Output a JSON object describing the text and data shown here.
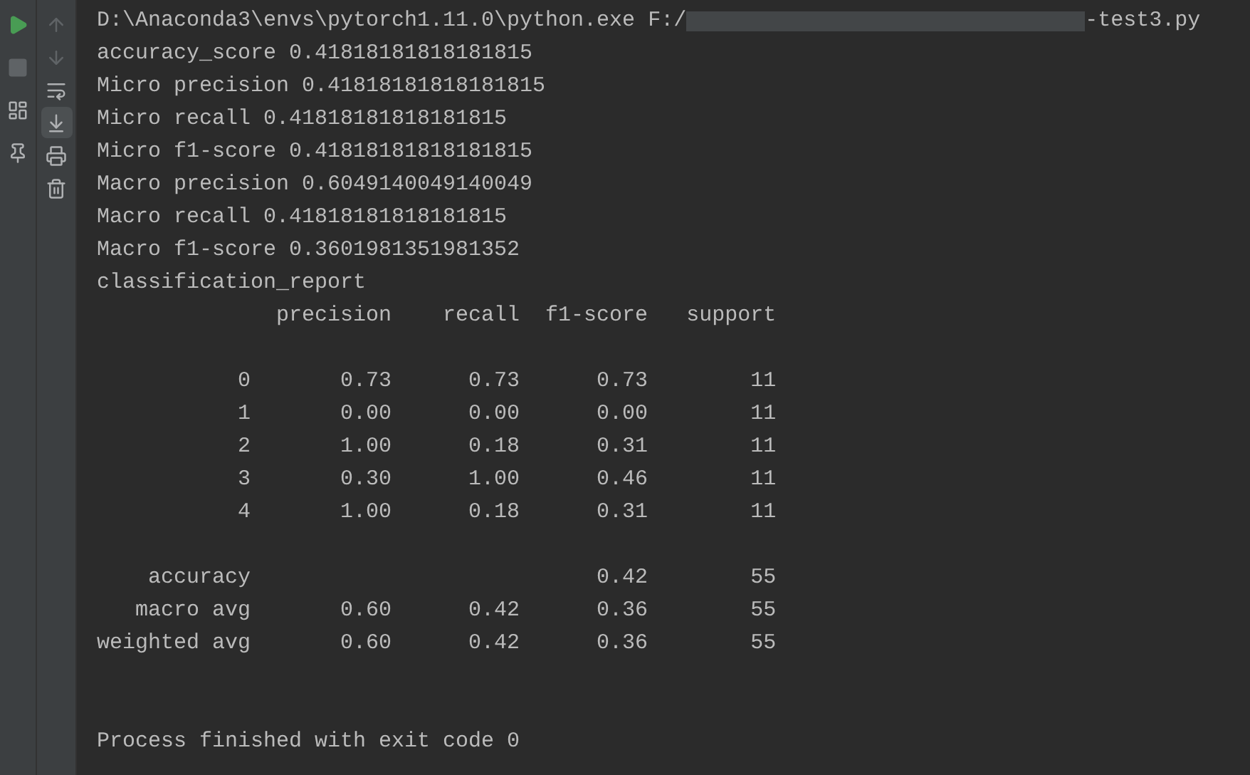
{
  "left_toolbar": [
    {
      "kind": "run",
      "disabled": false
    },
    {
      "kind": "stop",
      "disabled": true
    },
    {
      "kind": "layout",
      "disabled": false
    },
    {
      "kind": "pin",
      "disabled": false
    }
  ],
  "console_toolbar": [
    {
      "kind": "up",
      "disabled": true,
      "on": false
    },
    {
      "kind": "down",
      "disabled": true,
      "on": false
    },
    {
      "kind": "wrap",
      "disabled": false,
      "on": false
    },
    {
      "kind": "scroll_end",
      "disabled": false,
      "on": true
    },
    {
      "kind": "print",
      "disabled": false,
      "on": false
    },
    {
      "kind": "clear",
      "disabled": false,
      "on": false
    }
  ],
  "command": {
    "before": "D:\\Anaconda3\\envs\\pytorch1.11.0\\python.exe F:/",
    "after": "-test3.py"
  },
  "output": [
    "accuracy_score 0.41818181818181815",
    "Micro precision 0.41818181818181815",
    "Micro recall 0.41818181818181815",
    "Micro f1-score 0.41818181818181815",
    "Macro precision 0.6049140049140049",
    "Macro recall 0.41818181818181815",
    "Macro f1-score 0.3601981351981352",
    "classification_report"
  ],
  "report": {
    "header": "              precision    recall  f1-score   support",
    "rows": [
      "           0       0.73      0.73      0.73        11",
      "           1       0.00      0.00      0.00        11",
      "           2       1.00      0.18      0.31        11",
      "           3       0.30      1.00      0.46        11",
      "           4       1.00      0.18      0.31        11"
    ],
    "summary": [
      "    accuracy                           0.42        55",
      "   macro avg       0.60      0.42      0.36        55",
      "weighted avg       0.60      0.42      0.36        55"
    ]
  },
  "exit_message": "Process finished with exit code 0"
}
